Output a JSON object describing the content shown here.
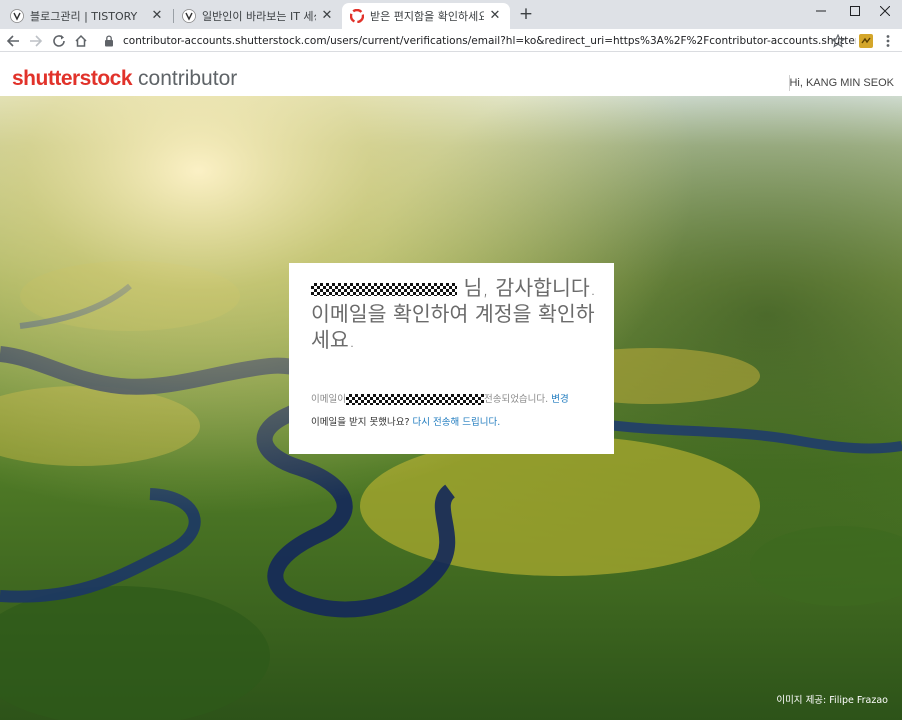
{
  "browser": {
    "tabs": [
      {
        "title": "블로그관리 | TISTORY",
        "icon": "tistory-favicon"
      },
      {
        "title": "일반인이 바라보는 IT 세상",
        "icon": "tistory-favicon"
      },
      {
        "title": "받은 편지함을 확인하세요. | Shu",
        "icon": "shutterstock-favicon",
        "active": true
      }
    ],
    "new_tab_symbol": "+",
    "close_symbol": "✕",
    "url": "contributor-accounts.shutterstock.com/users/current/verifications/email?hl=ko&redirect_uri=https%3A%2F%2Fcontributor-accounts.shutterstock.com%2Fo..."
  },
  "site": {
    "brand": "shutterstock",
    "brand_suffix": "contributor",
    "user_greeting": "Hi, KANG MIN SEOK",
    "brand_color": "#e1322a"
  },
  "card": {
    "heading_suffix": "님, 감사합니다.",
    "heading_body": "이메일을 확인하여 계정을 확인하세요.",
    "sent_prefix": "이메일이",
    "sent_suffix": "전송되었습니다.",
    "change_link": "변경",
    "not_received": "이메일을 받지 못했나요?",
    "resend_link": "다시 전송해 드립니다.",
    "link_color": "#1f7bbf"
  },
  "credit": {
    "label": "이미지 제공:",
    "author": "Filipe Frazao"
  }
}
